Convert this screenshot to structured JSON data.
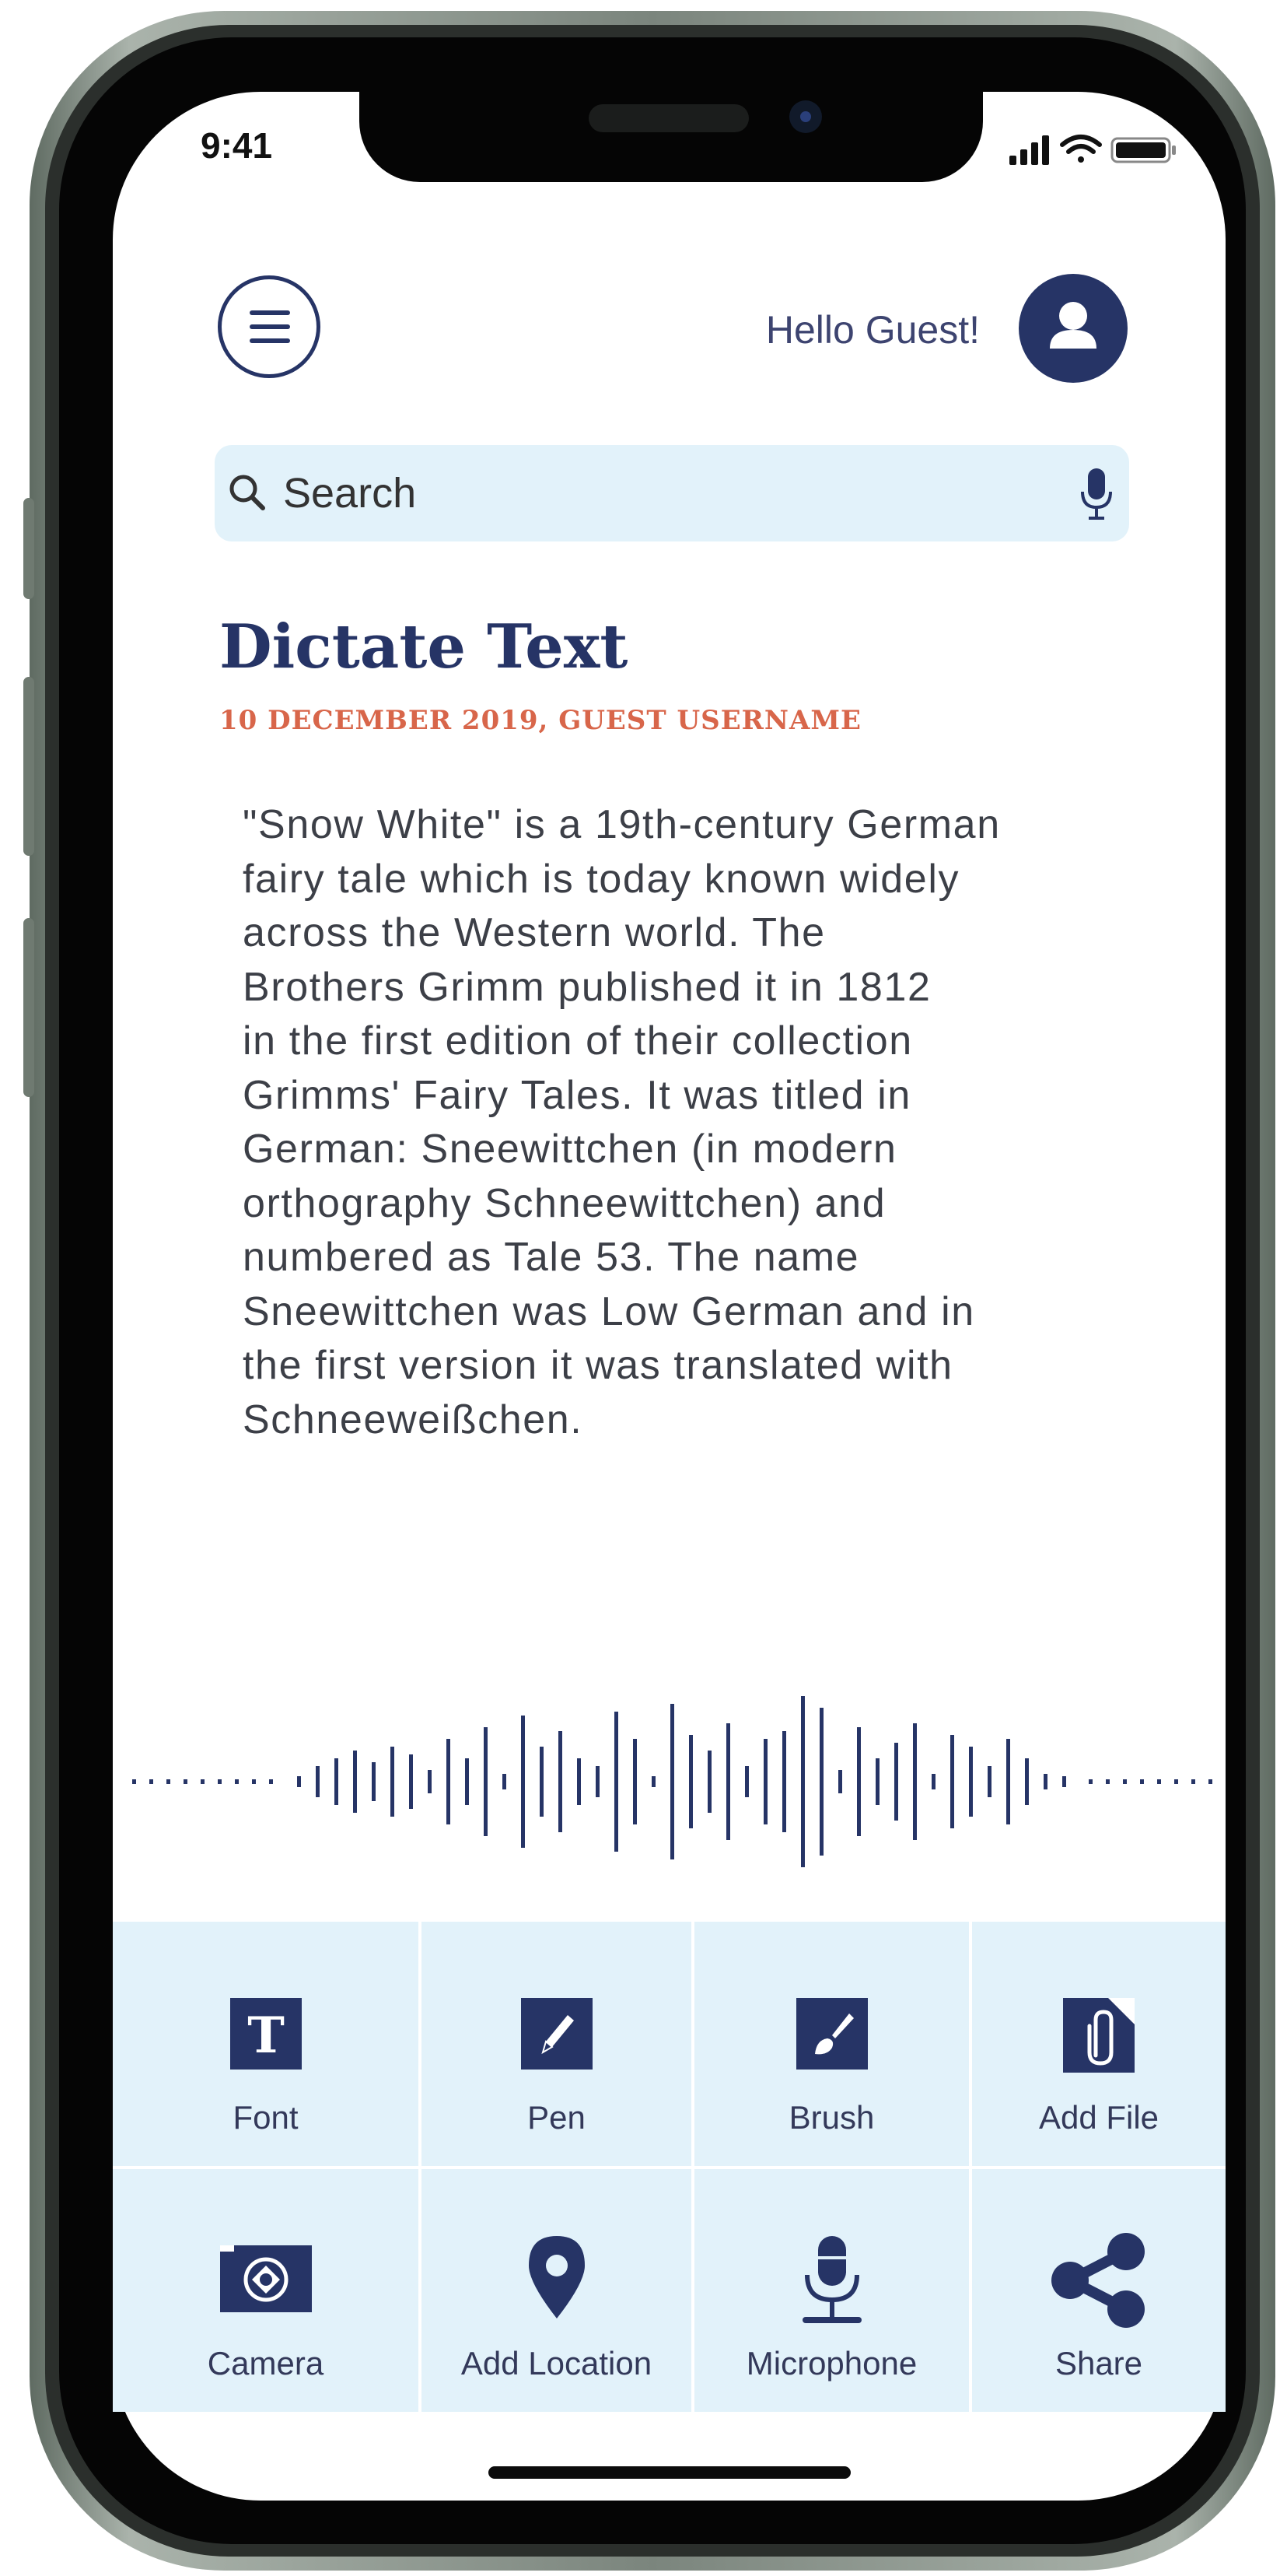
{
  "status": {
    "time": "9:41"
  },
  "header": {
    "greeting": "Hello Guest!"
  },
  "search": {
    "placeholder": "Search"
  },
  "article": {
    "title": "Dictate Text",
    "byline": "10 DECEMBER 2019, GUEST USERNAME",
    "lines": [
      "\"Snow White\" is a 19th-century German",
      "fairy tale which is today known widely",
      "across the Western world. The",
      "Brothers Grimm published it in 1812",
      "in the first edition of their collection",
      "Grimms' Fairy Tales. It was titled in",
      "German: Sneewittchen (in modern",
      "orthography Schneewittchen) and",
      "numbered as Tale 53. The name",
      "Sneewittchen was Low German and in",
      "the first version it was translated with",
      "Schneeweißchen."
    ]
  },
  "toolbar": {
    "row1": [
      {
        "label": "Font",
        "icon": "font-icon"
      },
      {
        "label": "Pen",
        "icon": "pen-icon"
      },
      {
        "label": "Brush",
        "icon": "brush-icon"
      },
      {
        "label": "Add File",
        "icon": "attach-file-icon"
      }
    ],
    "row2": [
      {
        "label": "Camera",
        "icon": "camera-icon"
      },
      {
        "label": "Add Location",
        "icon": "location-pin-icon"
      },
      {
        "label": "Microphone",
        "icon": "microphone-icon"
      },
      {
        "label": "Share",
        "icon": "share-icon"
      }
    ]
  },
  "colors": {
    "primary": "#263466",
    "accent": "#d8664a",
    "panel": "#e2f2fa"
  }
}
